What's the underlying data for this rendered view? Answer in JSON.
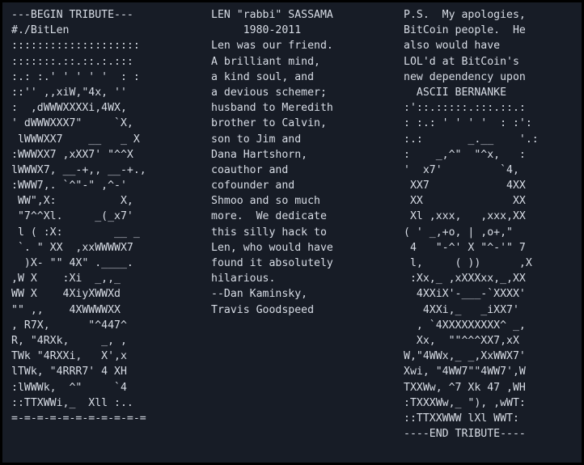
{
  "terminal": {
    "background_color": "#171c26",
    "text_color": "#d8dde6",
    "border_color": "#000000"
  },
  "columns": {
    "left": {
      "name": "ascii-bitlen-art",
      "lines": [
        "---BEGIN TRIBUTE---",
        "#./BitLen",
        "::::::::::::::::::::",
        ":::::::.::.::.:.:::",
        ":.: :.' ' ' ' '  : :",
        "::'' ,,xiW,\"4x, ''",
        ":  ,dWWWXXXXi,4WX,",
        "' dWWWXXX7\"     `X,",
        " lWWWXX7    __   _ X",
        ":WWWXX7 ,xXX7' \"^^X",
        "lWWWX7, __-+,, __-+.,",
        ":WWW7,. `^\"-\" ,^-'",
        " WW\",X:          X,",
        " \"7^^Xl.     _(_x7'",
        " l ( :X:        __ _",
        " `. \" XX  ,xxWWWWX7",
        "  )X- \"\" 4X\" .____.",
        ",W X    :Xi  _,,_",
        "WW X    4XiyXWWXd",
        "\"\" ,,    4XWWWWXX",
        ", R7X,      \"^447^",
        "R, \"4RXk,     _, ,",
        "TWk \"4RXXi,   X',x",
        "lTWk, \"4RRR7' 4 XH",
        ":lWWWk,  ^\"     `4",
        "::TTXWWi,_  Xll :..",
        "=-=-=-=-=-=-=-=-=-=-="
      ]
    },
    "middle": {
      "name": "tribute-text",
      "lines": [
        "LEN \"rabbi\" SASSAMA",
        "     1980-2011",
        "Len was our friend.",
        "A brilliant mind,",
        "a kind soul, and",
        "a devious schemer;",
        "husband to Meredith",
        "brother to Calvin,",
        "son to Jim and",
        "Dana Hartshorn,",
        "coauthor and",
        "cofounder and",
        "Shmoo and so much",
        "more.  We dedicate",
        "this silly hack to",
        "Len, who would have",
        "found it absolutely",
        "hilarious.",
        "--Dan Kaminsky,",
        "Travis Goodspeed"
      ]
    },
    "right": {
      "name": "ps-ascii-bernanke",
      "lines": [
        "P.S.  My apologies,",
        "BitCoin people.  He",
        "also would have",
        "LOL'd at BitCoin's",
        "new dependency upon",
        "  ASCII BERNANKE",
        ":'::.:::::.:::.::.:",
        ": :.: ' ' ' '  : :':",
        ":.:       _.__    '.:",
        ":    _,^\"  \"^x,   :",
        "'  x7'         `4,",
        " XX7            4XX",
        " XX              XX",
        " Xl ,xxx,   ,xxx,XX",
        "( ' _,+o, | ,o+,\"",
        " 4   \"-^' X \"^-'\" 7",
        " l,     ( ))      ,X",
        " :Xx,_ ,xXXXxx,_,XX",
        "  4XXiX'-___-`XXXX'",
        "   4XXi,_   _iXX7'",
        "  , `4XXXXXXXXX^ _,",
        "  Xx,  \"\"^^^XX7,xX",
        "W,\"4WWx,_ _,XxWWX7'",
        "Xwi, \"4WW7\"\"4WW7',W",
        "TXXWw, ^7 Xk 47 ,WH",
        ":TXXXWw,_ \"), ,wWT:",
        "::TTXXWWW lXl WWT:",
        "----END TRIBUTE----"
      ]
    }
  }
}
